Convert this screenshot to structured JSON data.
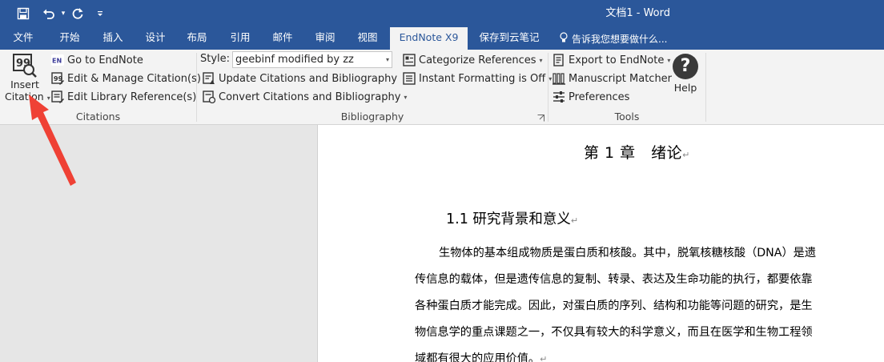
{
  "app": {
    "doc_title": "文档1 - Word"
  },
  "qat": {
    "save_icon": "save-icon",
    "undo_icon": "undo-icon",
    "redo_icon": "redo-icon",
    "customize_icon": "customize-qat-icon"
  },
  "tabs": [
    {
      "label": "文件"
    },
    {
      "label": "开始"
    },
    {
      "label": "插入"
    },
    {
      "label": "设计"
    },
    {
      "label": "布局"
    },
    {
      "label": "引用"
    },
    {
      "label": "邮件"
    },
    {
      "label": "审阅"
    },
    {
      "label": "视图"
    },
    {
      "label": "EndNote X9",
      "active": true
    },
    {
      "label": "保存到云笔记"
    }
  ],
  "tell_me": "告诉我您想要做什么...",
  "ribbon": {
    "citations": {
      "insert_line1": "Insert",
      "insert_line2": "Citation",
      "go_to_endnote": "Go to EndNote",
      "edit_manage": "Edit & Manage Citation(s)",
      "edit_library": "Edit Library Reference(s)",
      "group_label": "Citations"
    },
    "bibliography": {
      "style_label": "Style:",
      "style_value": "geebinf modified by zz",
      "update": "Update Citations and Bibliography",
      "convert": "Convert Citations and Bibliography",
      "categorize": "Categorize References",
      "instant_formatting": "Instant Formatting is Off",
      "group_label": "Bibliography"
    },
    "tools": {
      "export": "Export to EndNote",
      "manuscript": "Manuscript Matcher",
      "preferences": "Preferences",
      "help": "Help",
      "group_label": "Tools"
    }
  },
  "document": {
    "chapter_title": "第 1 章　绪论",
    "section_title": "1.1  研究背景和意义",
    "paragraph_lines": [
      "生物体的基本组成物质是蛋白质和核酸。其中，脱氧核糖核酸（DNA）是遗",
      "传信息的载体，但是遗传信息的复制、转录、表达及生命功能的执行，都要依靠",
      "各种蛋白质才能完成。因此，对蛋白质的序列、结构和功能等问题的研究，是生",
      "物信息学的重点课题之一，不仅具有较大的科学意义，而且在医学和生物工程领",
      "域都有很大的应用价值。"
    ],
    "paragraph_mark": "↵"
  },
  "colors": {
    "title_bar": "#2b579a",
    "ribbon": "#f3f3f3",
    "arrow": "#ef4135"
  }
}
